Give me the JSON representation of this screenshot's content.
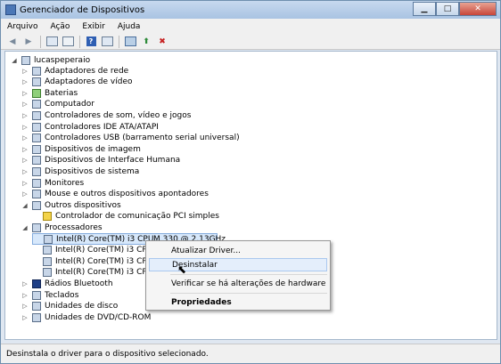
{
  "window": {
    "title": "Gerenciador de Dispositivos"
  },
  "menu": [
    "Arquivo",
    "Ação",
    "Exibir",
    "Ajuda"
  ],
  "tree": {
    "root": "lucaspeperaio",
    "categories": [
      "Adaptadores de rede",
      "Adaptadores de vídeo",
      "Baterias",
      "Computador",
      "Controladores de som, vídeo e jogos",
      "Controladores IDE ATA/ATAPI",
      "Controladores USB (barramento serial universal)",
      "Dispositivos de imagem",
      "Dispositivos de Interface Humana",
      "Dispositivos de sistema",
      "Monitores",
      "Mouse e outros dispositivos apontadores",
      "Outros dispositivos",
      "Controlador de comunicação PCI simples",
      "Processadores",
      "Intel(R) Core(TM) i3 CPU",
      "M 330  @ 2.13GHz",
      "Intel(R) Core(TM) i3 CPU",
      "Intel(R) Core(TM) i3 CPU",
      "Intel(R) Core(TM) i3 CPU",
      "Rádios Bluetooth",
      "Teclados",
      "Unidades de disco",
      "Unidades de DVD/CD-ROM"
    ]
  },
  "context_menu": {
    "update": "Atualizar Driver...",
    "uninstall": "Desinstalar",
    "scan": "Verificar se há alterações de hardware",
    "properties": "Propriedades"
  },
  "status": "Desinstala o driver para o dispositivo selecionado."
}
